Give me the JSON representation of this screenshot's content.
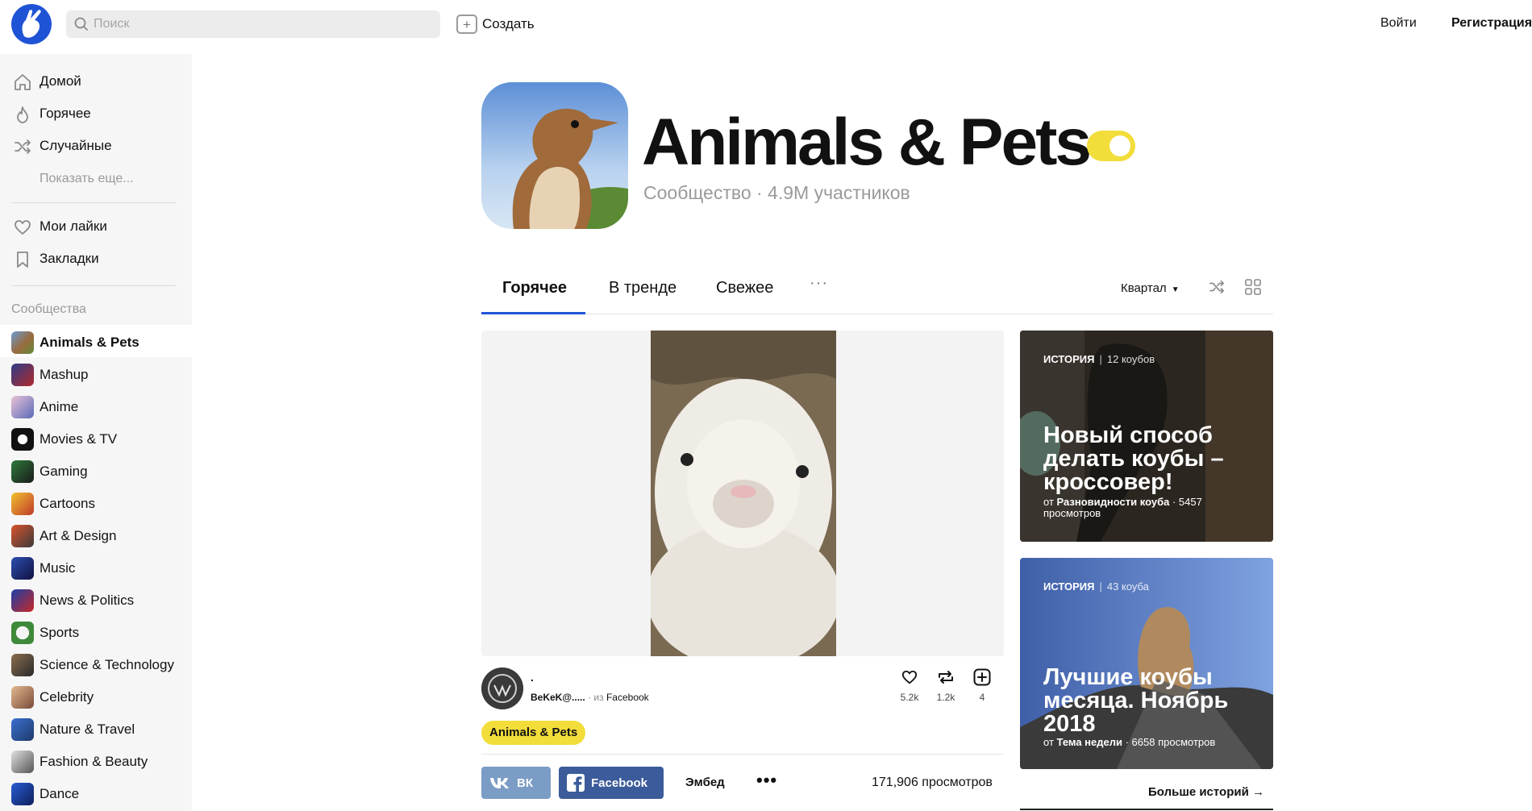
{
  "header": {
    "search_placeholder": "Поиск",
    "create_label": "Создать",
    "login_label": "Войти",
    "register_label": "Регистрация",
    "brand_color": "#1f53d6"
  },
  "sidebar": {
    "nav": [
      {
        "label": "Домой",
        "icon": "home-icon"
      },
      {
        "label": "Горячее",
        "icon": "flame-icon"
      },
      {
        "label": "Случайные",
        "icon": "shuffle-icon"
      }
    ],
    "show_more": "Показать еще...",
    "personal": [
      {
        "label": "Мои лайки",
        "icon": "heart-icon"
      },
      {
        "label": "Закладки",
        "icon": "bookmark-icon"
      }
    ],
    "communities_title": "Сообщества",
    "communities": [
      {
        "label": "Animals & Pets",
        "active": true
      },
      {
        "label": "Mashup"
      },
      {
        "label": "Anime"
      },
      {
        "label": "Movies & TV"
      },
      {
        "label": "Gaming"
      },
      {
        "label": "Cartoons"
      },
      {
        "label": "Art & Design"
      },
      {
        "label": "Music"
      },
      {
        "label": "News & Politics"
      },
      {
        "label": "Sports"
      },
      {
        "label": "Science & Technology"
      },
      {
        "label": "Celebrity"
      },
      {
        "label": "Nature & Travel"
      },
      {
        "label": "Fashion & Beauty"
      },
      {
        "label": "Dance"
      }
    ]
  },
  "community": {
    "title": "Animals & Pets",
    "subtitle": "Сообщество · 4.9M участников",
    "accent_color": "#f2dd3a"
  },
  "tabs": {
    "items": [
      "Горячее",
      "В тренде",
      "Свежее"
    ],
    "active_index": 0,
    "more": "···",
    "period": "Квартал",
    "underline_color": "#2355d9"
  },
  "post": {
    "title": ".",
    "author": "BeKeK@.....",
    "from_label": "из",
    "source": "Facebook",
    "likes": "5.2k",
    "recoubs": "1.2k",
    "bookmarks": "4",
    "tag": "Animals & Pets",
    "share_vk": "ВК",
    "share_fb": "Facebook",
    "embed": "Эмбед",
    "more": "•••",
    "views": "171,906 просмотров"
  },
  "stories": [
    {
      "label": "ИСТОРИЯ",
      "count": "12 коубов",
      "title": "Новый способ делать коубы – кроссовер!",
      "from": "от",
      "author": "Разновидности коуба",
      "views": "· 5457 просмотров"
    },
    {
      "label": "ИСТОРИЯ",
      "count": "43 коуба",
      "title": "Лучшие коубы месяца. Ноябрь 2018",
      "from": "от",
      "author": "Тема недели",
      "views": "· 6658 просмотров"
    }
  ],
  "more_stories": "Больше историй →"
}
